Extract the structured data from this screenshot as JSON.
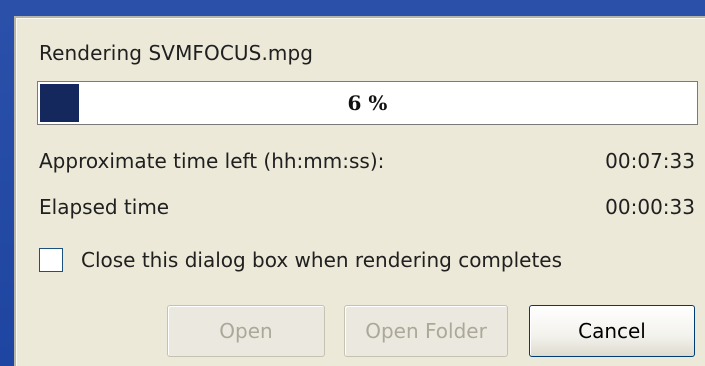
{
  "dialog": {
    "title_line": "Rendering SVMFOCUS.mpg",
    "progress": {
      "percent": 6,
      "label": "6 %"
    },
    "time_left": {
      "label": "Approximate time left (hh:mm:ss):",
      "value": "00:07:33"
    },
    "elapsed": {
      "label": "Elapsed time",
      "value": "00:00:33"
    },
    "close_when_done": {
      "label": "Close this dialog box when rendering completes",
      "checked": false
    },
    "buttons": {
      "open": "Open",
      "open_folder": "Open Folder",
      "cancel": "Cancel"
    }
  },
  "colors": {
    "desktop": "#1f47a6",
    "dialog_bg": "#ece9d8",
    "progress_fill": "#14285e"
  }
}
